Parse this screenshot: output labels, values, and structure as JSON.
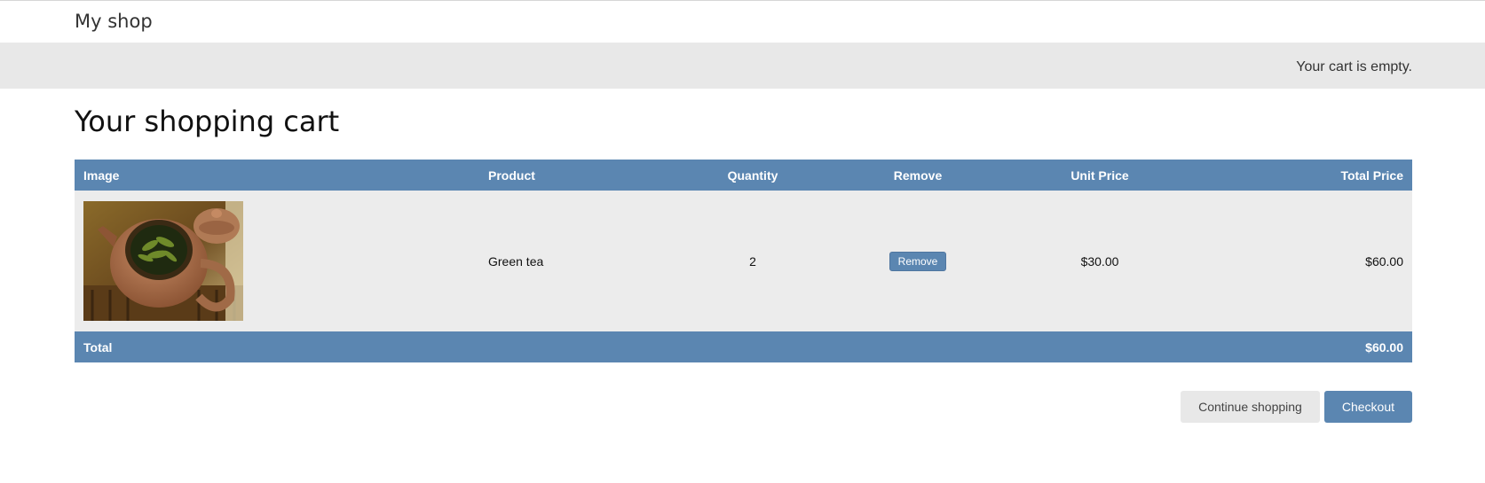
{
  "header": {
    "shop_name": "My shop"
  },
  "subheader": {
    "cart_status": "Your cart is empty."
  },
  "main": {
    "title": "Your shopping cart",
    "table": {
      "headers": [
        "Image",
        "Product",
        "Quantity",
        "Remove",
        "Unit Price",
        "Total Price"
      ],
      "rows": [
        {
          "image_icon": "teapot-with-green-tea-photo",
          "product": "Green tea",
          "quantity": "2",
          "remove_label": "Remove",
          "unit_price": "$30.00",
          "total_price": "$60.00"
        }
      ],
      "footer": {
        "label": "Total",
        "amount": "$60.00"
      }
    },
    "actions": {
      "continue_label": "Continue shopping",
      "checkout_label": "Checkout"
    }
  },
  "colors": {
    "accent": "#5b86b1",
    "subheader_bg": "#e8e8e8",
    "row_bg": "#ececec"
  }
}
